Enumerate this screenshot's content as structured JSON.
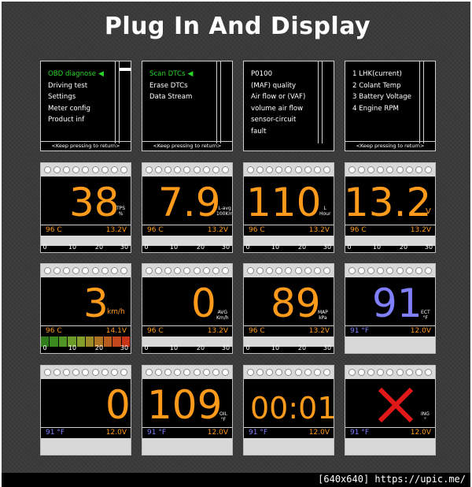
{
  "title": "Plug In And Display",
  "footer": "[640x640] https://upic.me/",
  "menus": [
    {
      "items": [
        "OBD diagnose",
        "Driving test",
        "Settings",
        "Meter config",
        "Product inf"
      ],
      "selected": 0,
      "hint": "<Keep pressing to return>"
    },
    {
      "items": [
        "Scan  DTCs",
        "Erase  DTCs",
        "Data Stream"
      ],
      "selected": 0,
      "hint": "<Keep pressing to return>"
    },
    {
      "items": [
        "P0100",
        "(MAF) quality",
        "Air flow or (VAF)",
        "volume air flow",
        "sensor-circuit",
        "fault"
      ],
      "selected": -1,
      "hint": ""
    },
    {
      "items": [
        "1 LHK(current)",
        "2 Colant Temp",
        "3 Battery Voltage",
        "4 Engine RPM"
      ],
      "selected": -1,
      "hint": "<Keep pressing to return>"
    }
  ],
  "gauges": [
    {
      "value": "38",
      "unit": "TPS\n%",
      "left": "96 C",
      "right": "13.2V",
      "scale": [
        "0",
        "10",
        "20",
        "30"
      ]
    },
    {
      "value": "7.9",
      "unit": "L-avg\n100Km",
      "left": "96 C",
      "right": "13.2V",
      "scale": [
        "0",
        "10",
        "20",
        "30"
      ]
    },
    {
      "value": "110",
      "unit": "L\nHour",
      "left": "96 C",
      "right": "13.2V",
      "scale": [
        "0",
        "10",
        "20",
        "30"
      ]
    },
    {
      "value": "13.2",
      "unit": "V",
      "left": "96 C",
      "right": "13.2V",
      "scale": [
        "0",
        "10",
        "20",
        "30"
      ]
    },
    {
      "value": "3",
      "unit": "km/h",
      "left": "96 C",
      "right": "14.1V",
      "scale": [
        "0",
        "10",
        "20",
        "30"
      ]
    },
    {
      "value": "0",
      "unit": "AVG\nKm/h",
      "left": "96 C",
      "right": "13.2V",
      "scale": [
        "0",
        "10",
        "20",
        "30"
      ]
    },
    {
      "value": "89",
      "unit": "MAP\nkPa",
      "left": "96 C",
      "right": "13.2V",
      "scale": [
        "0",
        "10",
        "20",
        "30"
      ]
    },
    {
      "value": "91",
      "unit": "ECT\n°F",
      "left": "91 °F",
      "right": "12.0V",
      "scale": []
    },
    {
      "value": "0",
      "unit": "",
      "left": "91 °F",
      "right": "12.0V",
      "scale": []
    },
    {
      "value": "109",
      "unit": "OIL\n°F",
      "left": "91 °F",
      "right": "12.0V",
      "scale": []
    },
    {
      "value": "00:01",
      "unit": "",
      "left": "91 °F",
      "right": "12.0V",
      "scale": []
    },
    {
      "value": "",
      "unit": "ING\n°",
      "left": "91 °F",
      "right": "12.0V",
      "scale": []
    }
  ],
  "colors": {
    "orange": "#ff9a1a",
    "blue": "#8080ff",
    "green": "#2bd62b",
    "red": "#e01818"
  },
  "icons": [
    "left-arrow-icon",
    "cross-icon"
  ]
}
